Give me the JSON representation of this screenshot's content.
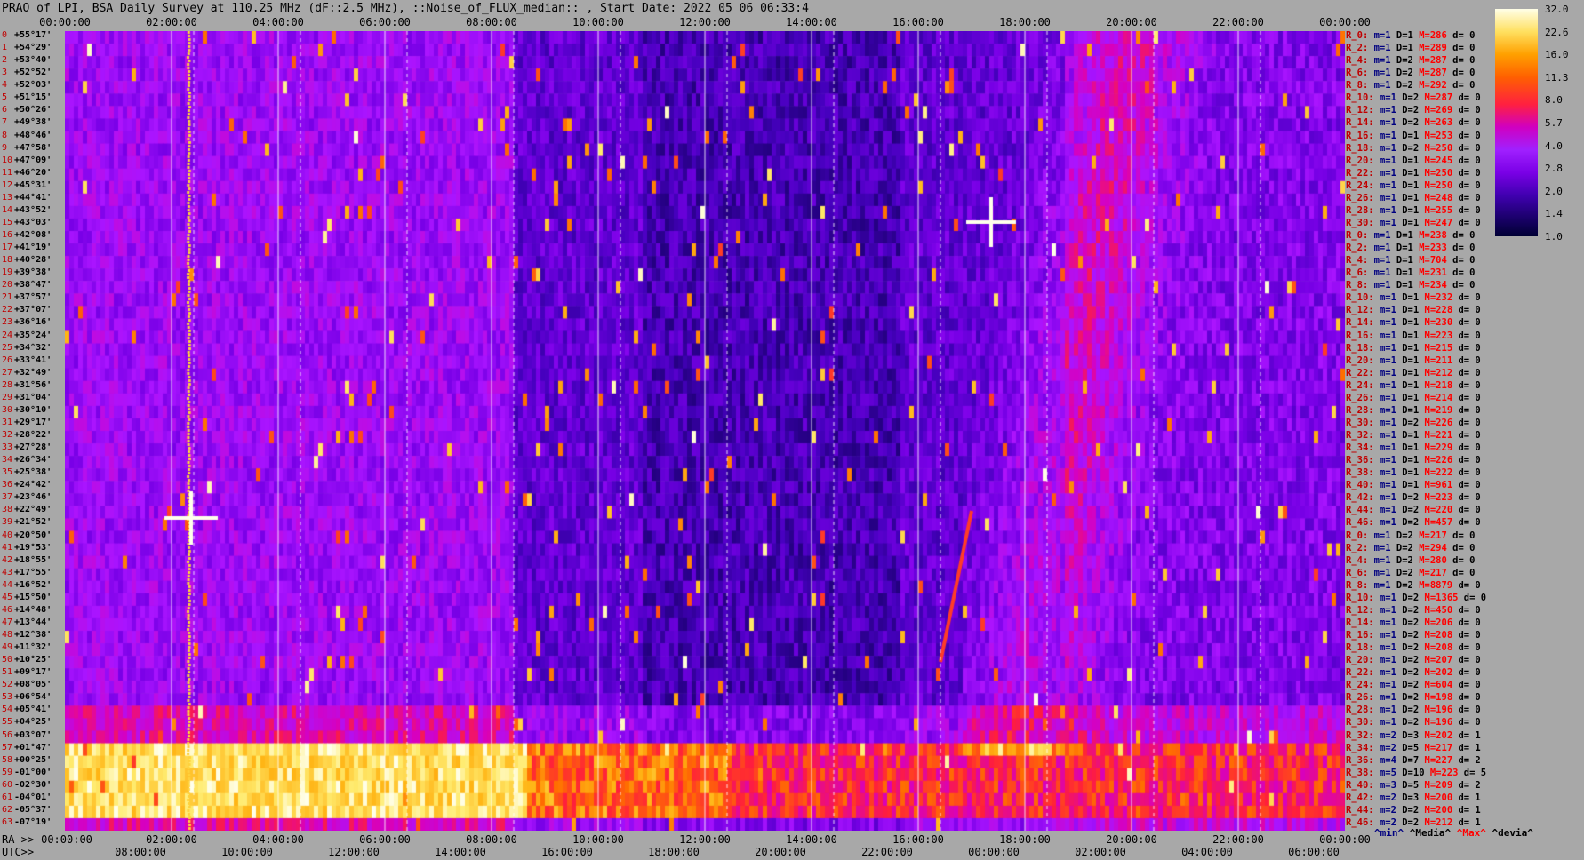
{
  "title": "PRAO of LPI, BSA Daily Survey at 110.25 MHz (dF::2.5 MHz), ::Noise_of_FLUX_median:: , Start Date: 2022 05 06 06:33:4",
  "ra_label": "RA >>",
  "utc_label": "UTC>>",
  "chart_data": {
    "type": "heatmap",
    "title": "PRAO of LPI, BSA Daily Survey at 110.25 MHz (dF::2.5 MHz), ::Noise_of_FLUX_median:: , Start Date: 2022 05 06 06:33:4",
    "x_top_ticks": [
      "00:00:00",
      "02:00:00",
      "04:00:00",
      "06:00:00",
      "08:00:00",
      "10:00:00",
      "12:00:00",
      "14:00:00",
      "16:00:00",
      "18:00:00",
      "20:00:00",
      "22:00:00",
      "00:00:00"
    ],
    "x_ra_ticks": [
      "00:00:00",
      "02:00:00",
      "04:00:00",
      "06:00:00",
      "08:00:00",
      "10:00:00",
      "12:00:00",
      "14:00:00",
      "16:00:00",
      "18:00:00",
      "20:00:00",
      "22:00:00",
      "00:00:00"
    ],
    "x_utc_ticks": [
      "08:00:00",
      "10:00:00",
      "12:00:00",
      "14:00:00",
      "16:00:00",
      "18:00:00",
      "20:00:00",
      "22:00:00",
      "00:00:00",
      "02:00:00",
      "04:00:00",
      "06:00:00"
    ],
    "y_ticks": [
      {
        "i": "0",
        "d": "+55°17'"
      },
      {
        "i": "1",
        "d": "+54°29'"
      },
      {
        "i": "2",
        "d": "+53°40'"
      },
      {
        "i": "3",
        "d": "+52°52'"
      },
      {
        "i": "4",
        "d": "+52°03'"
      },
      {
        "i": "5",
        "d": "+51°15'"
      },
      {
        "i": "6",
        "d": "+50°26'"
      },
      {
        "i": "7",
        "d": "+49°38'"
      },
      {
        "i": "8",
        "d": "+48°46'"
      },
      {
        "i": "9",
        "d": "+47°58'"
      },
      {
        "i": "10",
        "d": "+47°09'"
      },
      {
        "i": "11",
        "d": "+46°20'"
      },
      {
        "i": "12",
        "d": "+45°31'"
      },
      {
        "i": "13",
        "d": "+44°41'"
      },
      {
        "i": "14",
        "d": "+43°52'"
      },
      {
        "i": "15",
        "d": "+43°03'"
      },
      {
        "i": "16",
        "d": "+42°08'"
      },
      {
        "i": "17",
        "d": "+41°19'"
      },
      {
        "i": "18",
        "d": "+40°28'"
      },
      {
        "i": "19",
        "d": "+39°38'"
      },
      {
        "i": "20",
        "d": "+38°47'"
      },
      {
        "i": "21",
        "d": "+37°57'"
      },
      {
        "i": "22",
        "d": "+37°07'"
      },
      {
        "i": "23",
        "d": "+36°16'"
      },
      {
        "i": "24",
        "d": "+35°24'"
      },
      {
        "i": "25",
        "d": "+34°32'"
      },
      {
        "i": "26",
        "d": "+33°41'"
      },
      {
        "i": "27",
        "d": "+32°49'"
      },
      {
        "i": "28",
        "d": "+31°56'"
      },
      {
        "i": "29",
        "d": "+31°04'"
      },
      {
        "i": "30",
        "d": "+30°10'"
      },
      {
        "i": "31",
        "d": "+29°17'"
      },
      {
        "i": "32",
        "d": "+28°22'"
      },
      {
        "i": "33",
        "d": "+27°28'"
      },
      {
        "i": "34",
        "d": "+26°34'"
      },
      {
        "i": "35",
        "d": "+25°38'"
      },
      {
        "i": "36",
        "d": "+24°42'"
      },
      {
        "i": "37",
        "d": "+23°46'"
      },
      {
        "i": "38",
        "d": "+22°49'"
      },
      {
        "i": "39",
        "d": "+21°52'"
      },
      {
        "i": "40",
        "d": "+20°50'"
      },
      {
        "i": "41",
        "d": "+19°53'"
      },
      {
        "i": "42",
        "d": "+18°55'"
      },
      {
        "i": "43",
        "d": "+17°55'"
      },
      {
        "i": "44",
        "d": "+16°52'"
      },
      {
        "i": "45",
        "d": "+15°50'"
      },
      {
        "i": "46",
        "d": "+14°48'"
      },
      {
        "i": "47",
        "d": "+13°44'"
      },
      {
        "i": "48",
        "d": "+12°38'"
      },
      {
        "i": "49",
        "d": "+11°32'"
      },
      {
        "i": "50",
        "d": "+10°25'"
      },
      {
        "i": "51",
        "d": "+09°17'"
      },
      {
        "i": "52",
        "d": "+08°05'"
      },
      {
        "i": "53",
        "d": "+06°54'"
      },
      {
        "i": "54",
        "d": "+05°41'"
      },
      {
        "i": "55",
        "d": "+04°25'"
      },
      {
        "i": "56",
        "d": "+03°07'"
      },
      {
        "i": "57",
        "d": "+01°47'"
      },
      {
        "i": "58",
        "d": "+00°25'"
      },
      {
        "i": "59",
        "d": "-01°00'"
      },
      {
        "i": "60",
        "d": "-02°30'"
      },
      {
        "i": "61",
        "d": "-04°01'"
      },
      {
        "i": "62",
        "d": "-05°37'"
      },
      {
        "i": "63",
        "d": "-07°19'"
      }
    ],
    "colorbar": {
      "ticks": [
        "32.0",
        "22.6",
        "16.0",
        "11.3",
        "8.0",
        "5.7",
        "4.0",
        "2.8",
        "2.0",
        "1.4",
        "1.0"
      ]
    },
    "row_stats": [
      {
        "r": "R_0:",
        "m": "m=1",
        "D": "D=1",
        "M": "M=286",
        "d": "d= 0"
      },
      {
        "r": "R_2:",
        "m": "m=1",
        "D": "D=1",
        "M": "M=289",
        "d": "d= 0"
      },
      {
        "r": "R_4:",
        "m": "m=1",
        "D": "D=2",
        "M": "M=287",
        "d": "d= 0"
      },
      {
        "r": "R_6:",
        "m": "m=1",
        "D": "D=2",
        "M": "M=287",
        "d": "d= 0"
      },
      {
        "r": "R_8:",
        "m": "m=1",
        "D": "D=2",
        "M": "M=292",
        "d": "d= 0"
      },
      {
        "r": "R_10:",
        "m": "m=1",
        "D": "D=2",
        "M": "M=287",
        "d": "d= 0"
      },
      {
        "r": "R_12:",
        "m": "m=1",
        "D": "D=2",
        "M": "M=269",
        "d": "d= 0"
      },
      {
        "r": "R_14:",
        "m": "m=1",
        "D": "D=2",
        "M": "M=263",
        "d": "d= 0"
      },
      {
        "r": "R_16:",
        "m": "m=1",
        "D": "D=1",
        "M": "M=253",
        "d": "d= 0"
      },
      {
        "r": "R_18:",
        "m": "m=1",
        "D": "D=2",
        "M": "M=250",
        "d": "d= 0"
      },
      {
        "r": "R_20:",
        "m": "m=1",
        "D": "D=1",
        "M": "M=245",
        "d": "d= 0"
      },
      {
        "r": "R_22:",
        "m": "m=1",
        "D": "D=1",
        "M": "M=250",
        "d": "d= 0"
      },
      {
        "r": "R_24:",
        "m": "m=1",
        "D": "D=1",
        "M": "M=250",
        "d": "d= 0"
      },
      {
        "r": "R_26:",
        "m": "m=1",
        "D": "D=1",
        "M": "M=248",
        "d": "d= 0"
      },
      {
        "r": "R_28:",
        "m": "m=1",
        "D": "D=1",
        "M": "M=255",
        "d": "d= 0"
      },
      {
        "r": "R_30:",
        "m": "m=1",
        "D": "D=1",
        "M": "M=247",
        "d": "d= 0"
      },
      {
        "r": "R_0:",
        "m": "m=1",
        "D": "D=1",
        "M": "M=238",
        "d": "d= 0"
      },
      {
        "r": "R_2:",
        "m": "m=1",
        "D": "D=1",
        "M": "M=233",
        "d": "d= 0"
      },
      {
        "r": "R_4:",
        "m": "m=1",
        "D": "D=1",
        "M": "M=704",
        "d": "d= 0"
      },
      {
        "r": "R_6:",
        "m": "m=1",
        "D": "D=1",
        "M": "M=231",
        "d": "d= 0"
      },
      {
        "r": "R_8:",
        "m": "m=1",
        "D": "D=1",
        "M": "M=234",
        "d": "d= 0"
      },
      {
        "r": "R_10:",
        "m": "m=1",
        "D": "D=1",
        "M": "M=232",
        "d": "d= 0"
      },
      {
        "r": "R_12:",
        "m": "m=1",
        "D": "D=1",
        "M": "M=228",
        "d": "d= 0"
      },
      {
        "r": "R_14:",
        "m": "m=1",
        "D": "D=1",
        "M": "M=230",
        "d": "d= 0"
      },
      {
        "r": "R_16:",
        "m": "m=1",
        "D": "D=1",
        "M": "M=223",
        "d": "d= 0"
      },
      {
        "r": "R_18:",
        "m": "m=1",
        "D": "D=1",
        "M": "M=215",
        "d": "d= 0"
      },
      {
        "r": "R_20:",
        "m": "m=1",
        "D": "D=1",
        "M": "M=211",
        "d": "d= 0"
      },
      {
        "r": "R_22:",
        "m": "m=1",
        "D": "D=1",
        "M": "M=212",
        "d": "d= 0"
      },
      {
        "r": "R_24:",
        "m": "m=1",
        "D": "D=1",
        "M": "M=218",
        "d": "d= 0"
      },
      {
        "r": "R_26:",
        "m": "m=1",
        "D": "D=1",
        "M": "M=214",
        "d": "d= 0"
      },
      {
        "r": "R_28:",
        "m": "m=1",
        "D": "D=1",
        "M": "M=219",
        "d": "d= 0"
      },
      {
        "r": "R_30:",
        "m": "m=1",
        "D": "D=2",
        "M": "M=226",
        "d": "d= 0"
      },
      {
        "r": "R_32:",
        "m": "m=1",
        "D": "D=1",
        "M": "M=221",
        "d": "d= 0"
      },
      {
        "r": "R_34:",
        "m": "m=1",
        "D": "D=1",
        "M": "M=229",
        "d": "d= 0"
      },
      {
        "r": "R_36:",
        "m": "m=1",
        "D": "D=1",
        "M": "M=226",
        "d": "d= 0"
      },
      {
        "r": "R_38:",
        "m": "m=1",
        "D": "D=1",
        "M": "M=222",
        "d": "d= 0"
      },
      {
        "r": "R_40:",
        "m": "m=1",
        "D": "D=1",
        "M": "M=961",
        "d": "d= 0"
      },
      {
        "r": "R_42:",
        "m": "m=1",
        "D": "D=2",
        "M": "M=223",
        "d": "d= 0"
      },
      {
        "r": "R_44:",
        "m": "m=1",
        "D": "D=2",
        "M": "M=220",
        "d": "d= 0"
      },
      {
        "r": "R_46:",
        "m": "m=1",
        "D": "D=2",
        "M": "M=457",
        "d": "d= 0"
      },
      {
        "r": "R_0:",
        "m": "m=1",
        "D": "D=2",
        "M": "M=217",
        "d": "d= 0"
      },
      {
        "r": "R_2:",
        "m": "m=1",
        "D": "D=2",
        "M": "M=294",
        "d": "d= 0"
      },
      {
        "r": "R_4:",
        "m": "m=1",
        "D": "D=2",
        "M": "M=280",
        "d": "d= 0"
      },
      {
        "r": "R_6:",
        "m": "m=1",
        "D": "D=2",
        "M": "M=217",
        "d": "d= 0"
      },
      {
        "r": "R_8:",
        "m": "m=1",
        "D": "D=2",
        "M": "M=8879",
        "d": "d= 0"
      },
      {
        "r": "R_10:",
        "m": "m=1",
        "D": "D=2",
        "M": "M=1365",
        "d": "d= 0"
      },
      {
        "r": "R_12:",
        "m": "m=1",
        "D": "D=2",
        "M": "M=450",
        "d": "d= 0"
      },
      {
        "r": "R_14:",
        "m": "m=1",
        "D": "D=2",
        "M": "M=206",
        "d": "d= 0"
      },
      {
        "r": "R_16:",
        "m": "m=1",
        "D": "D=2",
        "M": "M=208",
        "d": "d= 0"
      },
      {
        "r": "R_18:",
        "m": "m=1",
        "D": "D=2",
        "M": "M=208",
        "d": "d= 0"
      },
      {
        "r": "R_20:",
        "m": "m=1",
        "D": "D=2",
        "M": "M=207",
        "d": "d= 0"
      },
      {
        "r": "R_22:",
        "m": "m=1",
        "D": "D=2",
        "M": "M=202",
        "d": "d= 0"
      },
      {
        "r": "R_24:",
        "m": "m=1",
        "D": "D=2",
        "M": "M=604",
        "d": "d= 0"
      },
      {
        "r": "R_26:",
        "m": "m=1",
        "D": "D=2",
        "M": "M=198",
        "d": "d= 0"
      },
      {
        "r": "R_28:",
        "m": "m=1",
        "D": "D=2",
        "M": "M=196",
        "d": "d= 0"
      },
      {
        "r": "R_30:",
        "m": "m=1",
        "D": "D=2",
        "M": "M=196",
        "d": "d= 0"
      },
      {
        "r": "R_32:",
        "m": "m=2",
        "D": "D=3",
        "M": "M=202",
        "d": "d= 1"
      },
      {
        "r": "R_34:",
        "m": "m=2",
        "D": "D=5",
        "M": "M=217",
        "d": "d= 1"
      },
      {
        "r": "R_36:",
        "m": "m=4",
        "D": "D=7",
        "M": "M=227",
        "d": "d= 2"
      },
      {
        "r": "R_38:",
        "m": "m=5",
        "D": "D=10",
        "M": "M=223",
        "d": "d= 5"
      },
      {
        "r": "R_40:",
        "m": "m=3",
        "D": "D=5",
        "M": "M=209",
        "d": "d= 2"
      },
      {
        "r": "R_42:",
        "m": "m=2",
        "D": "D=3",
        "M": "M=200",
        "d": "d= 1"
      },
      {
        "r": "R_44:",
        "m": "m=2",
        "D": "D=2",
        "M": "M=200",
        "d": "d= 1"
      },
      {
        "r": "R_46:",
        "m": "m=2",
        "D": "D=2",
        "M": "M=212",
        "d": "d= 1"
      }
    ],
    "legend": {
      "min": "^min^",
      "median": "^Media^",
      "max": "^Max^",
      "devia": "^devia^"
    },
    "colors": {
      "background": "#a8a8a8",
      "low": "#000033",
      "mid": "#7a00e6",
      "high": "#ff2040",
      "peak": "#ffffe8"
    }
  }
}
